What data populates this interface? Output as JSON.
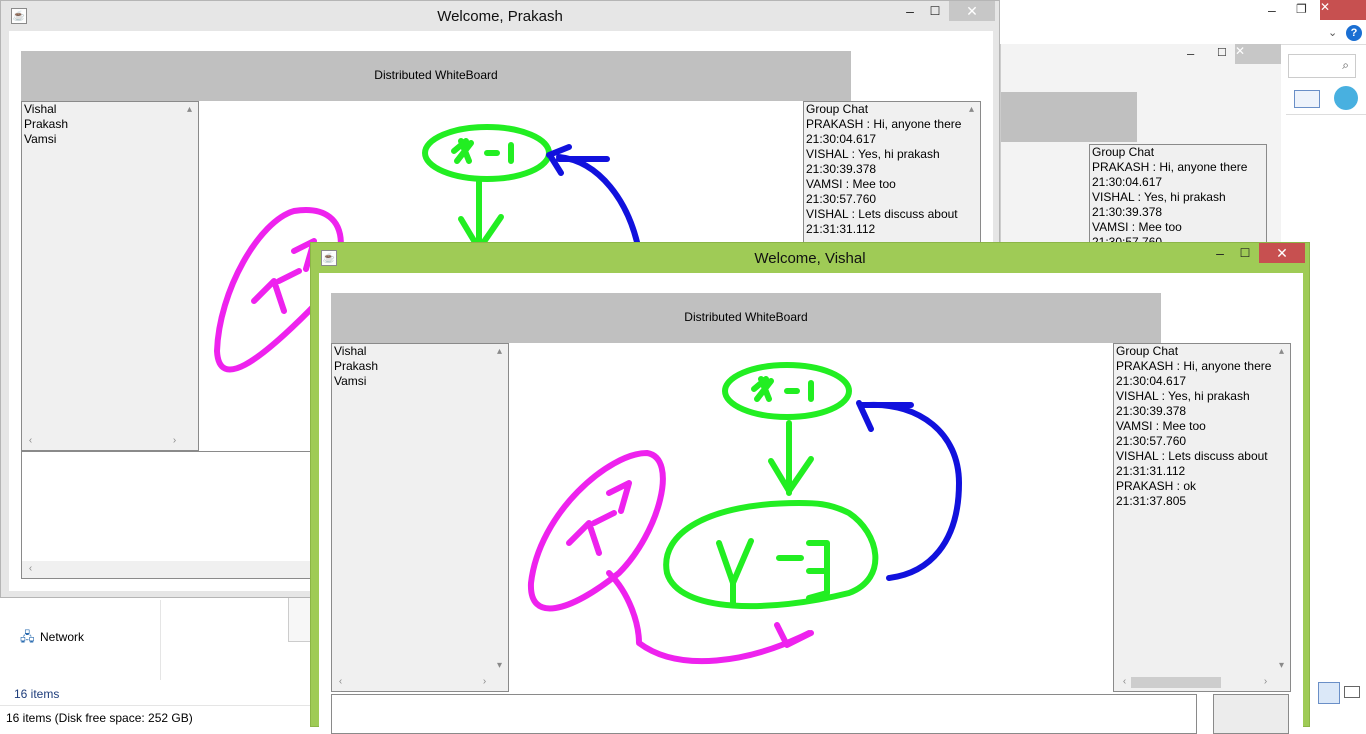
{
  "explorer": {
    "nav_network": "Network",
    "status_items": "16 items",
    "status_disk": "16 items (Disk free space: 252 GB)"
  },
  "back_window": {
    "title": "Welcome, Prakash",
    "header": "Distributed WhiteBoard",
    "users": [
      "Vishal",
      "Prakash",
      "Vamsi"
    ],
    "chat": [
      "Group Chat",
      "PRAKASH : Hi, anyone there",
      "21:30:04.617",
      "VISHAL : Yes, hi prakash",
      "21:30:39.378",
      "VAMSI : Mee too",
      "21:30:57.760",
      "VISHAL : Lets discuss about",
      "21:31:31.112"
    ]
  },
  "mid_window": {
    "chat": [
      "Group Chat",
      "PRAKASH : Hi, anyone there",
      "21:30:04.617",
      "VISHAL : Yes, hi prakash",
      "21:30:39.378",
      "VAMSI : Mee too",
      "21:30:57.760"
    ]
  },
  "front_window": {
    "title": "Welcome, Vishal",
    "header": "Distributed WhiteBoard",
    "users": [
      "Vishal",
      "Prakash",
      "Vamsi"
    ],
    "chat": [
      "Group Chat",
      "PRAKASH : Hi, anyone there",
      "21:30:04.617",
      "VISHAL : Yes, hi prakash",
      "21:30:39.378",
      "VAMSI : Mee too",
      "21:30:57.760",
      "VISHAL : Lets discuss about",
      "21:31:31.112",
      "PRAKASH : ok",
      "21:31:37.805"
    ]
  },
  "colors": {
    "active_frame": "#9fcb56",
    "inactive_frame": "#e6e6e6",
    "close_active": "#c75050",
    "stroke_green": "#22ee22",
    "stroke_magenta": "#ee22ee",
    "stroke_blue": "#1111dd"
  }
}
